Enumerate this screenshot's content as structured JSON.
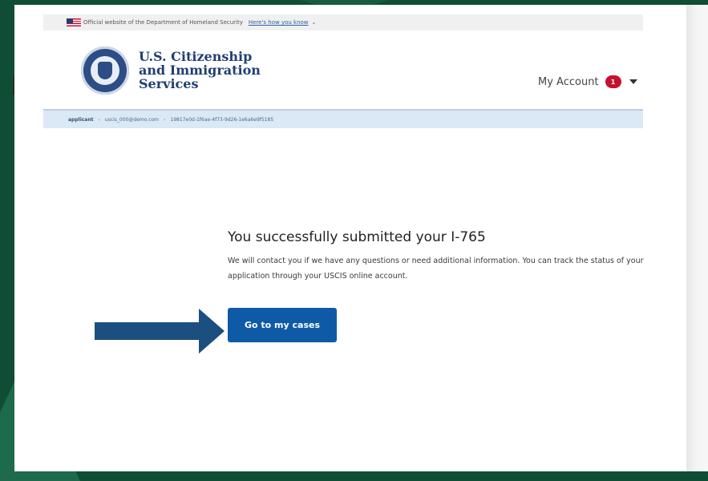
{
  "colors": {
    "backdrop": "#0f4d34",
    "primary_button": "#0e5aa7",
    "arrow": "#1b4f80",
    "notification_badge": "#c8102e",
    "agency_text": "#203f73"
  },
  "gov_banner": {
    "text": "Official website of the Department of Homeland Security",
    "link": "Here's how you know",
    "flag_icon": "us-flag-icon",
    "chevron_icon": "chevron-down-icon"
  },
  "header": {
    "seal_icon": "dhs-seal-icon",
    "agency_lines": [
      "U.S. Citizenship",
      "and Immigration",
      "Services"
    ],
    "my_account_label": "My Account",
    "notification_count": "1",
    "caret_icon": "caret-down-icon"
  },
  "breadcrumb": {
    "items": [
      "applicant",
      "uscis_000@demo.com",
      "19817e0d-1f6ae-4f73-9d26-1e6a6e9f5185"
    ]
  },
  "main": {
    "title": "You successfully submitted your I-765",
    "message": "We will contact you if we have any questions or need additional information. You can track the status of your application through your USCIS online account.",
    "cta_label": "Go to my cases",
    "pointer_icon": "arrow-right-icon"
  }
}
